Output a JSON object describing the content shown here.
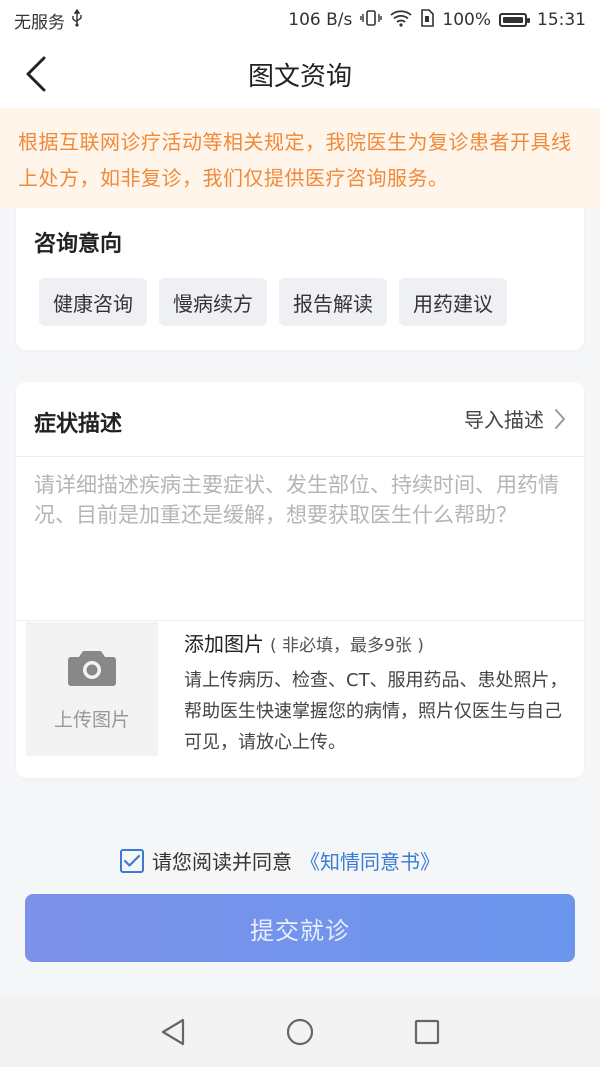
{
  "status": {
    "carrier": "无服务",
    "speed": "106 B/s",
    "battery": "100%",
    "time": "15:31"
  },
  "header": {
    "title": "图文资询"
  },
  "notice": {
    "text": "根据互联网诊疗活动等相关规定，我院医生为复诊患者开具线上处方，如非复诊，我们仅提供医疗咨询服务。"
  },
  "intent": {
    "title": "咨询意向",
    "options": [
      "健康咨询",
      "慢病续方",
      "报告解读",
      "用药建议"
    ]
  },
  "symptom": {
    "title": "症状描述",
    "import_label": "导入描述",
    "placeholder": "请详细描述疾病主要症状、发生部位、持续时间、用药情况、目前是加重还是缓解，想要获取医生什么帮助？",
    "value": ""
  },
  "upload": {
    "button_label": "上传图片",
    "title": "添加图片",
    "note": "( 非必填，最多9张 )",
    "description": "请上传病历、检查、CT、服用药品、患处照片，帮助医生快速掌握您的病情，照片仅医生与自己可见，请放心上传。"
  },
  "consent": {
    "text": "请您阅读并同意",
    "link": "《知情同意书》",
    "checked": true
  },
  "submit": {
    "label": "提交就诊"
  },
  "colors": {
    "accent": "#3a7bd5",
    "notice_text": "#f08a3a",
    "notice_bg": "#fff5eb"
  }
}
